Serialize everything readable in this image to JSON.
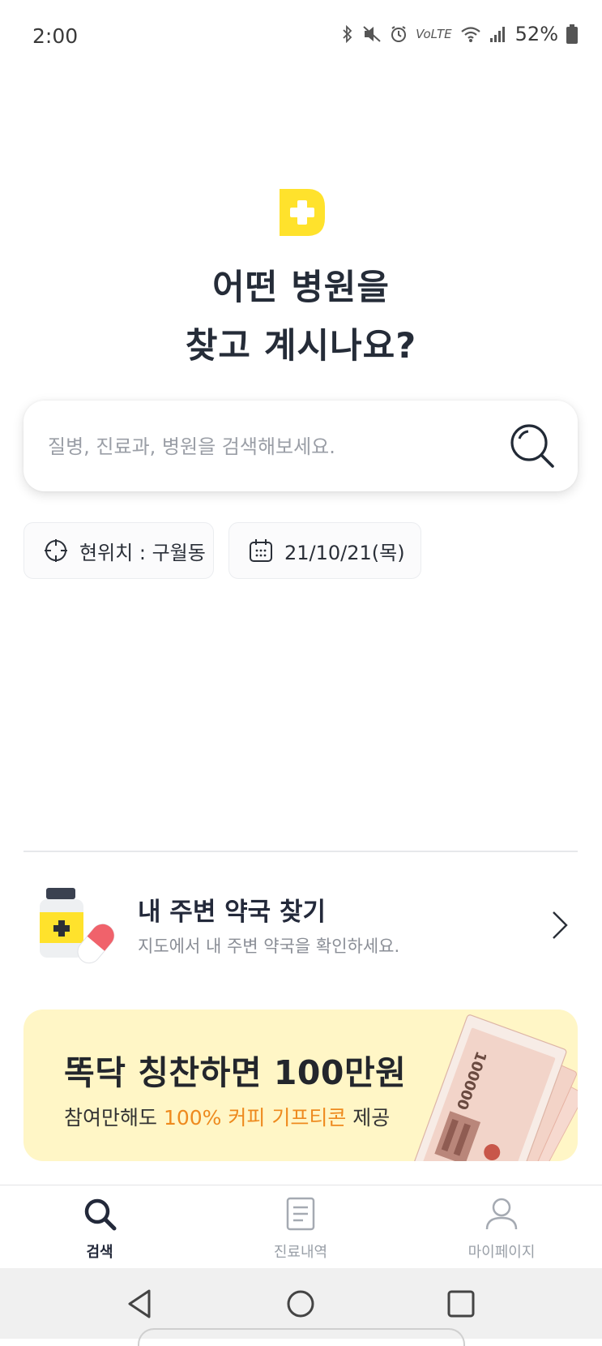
{
  "status_bar": {
    "time": "2:00",
    "network_text": "VoLTE",
    "battery": "52%"
  },
  "hero": {
    "line1": "어떤 병원을",
    "line2": "찾고 계시나요?"
  },
  "search": {
    "placeholder": "질병, 진료과, 병원을 검색해보세요."
  },
  "chips": {
    "location": "현위치 : 구월동",
    "date": "21/10/21(목)"
  },
  "pharmacy": {
    "title": "내 주변 약국 찾기",
    "subtitle": "지도에서 내 주변 약국을 확인하세요."
  },
  "banner": {
    "title": "똑닥 칭찬하면 100만원",
    "sub_prefix": "참여만해도 ",
    "sub_highlight": "100% 커피 기프티콘",
    "sub_suffix": " 제공",
    "bill_value": "100000"
  },
  "bottom_nav": {
    "items": [
      {
        "label": "검색",
        "icon": "search-icon",
        "active": true
      },
      {
        "label": "진료내역",
        "icon": "document-icon",
        "active": false
      },
      {
        "label": "마이페이지",
        "icon": "person-icon",
        "active": false
      }
    ]
  },
  "colors": {
    "brand_yellow": "#ffe22c",
    "banner_bg": "#fff6c6",
    "highlight_orange": "#ee8a1e",
    "text_dark": "#23293a"
  }
}
